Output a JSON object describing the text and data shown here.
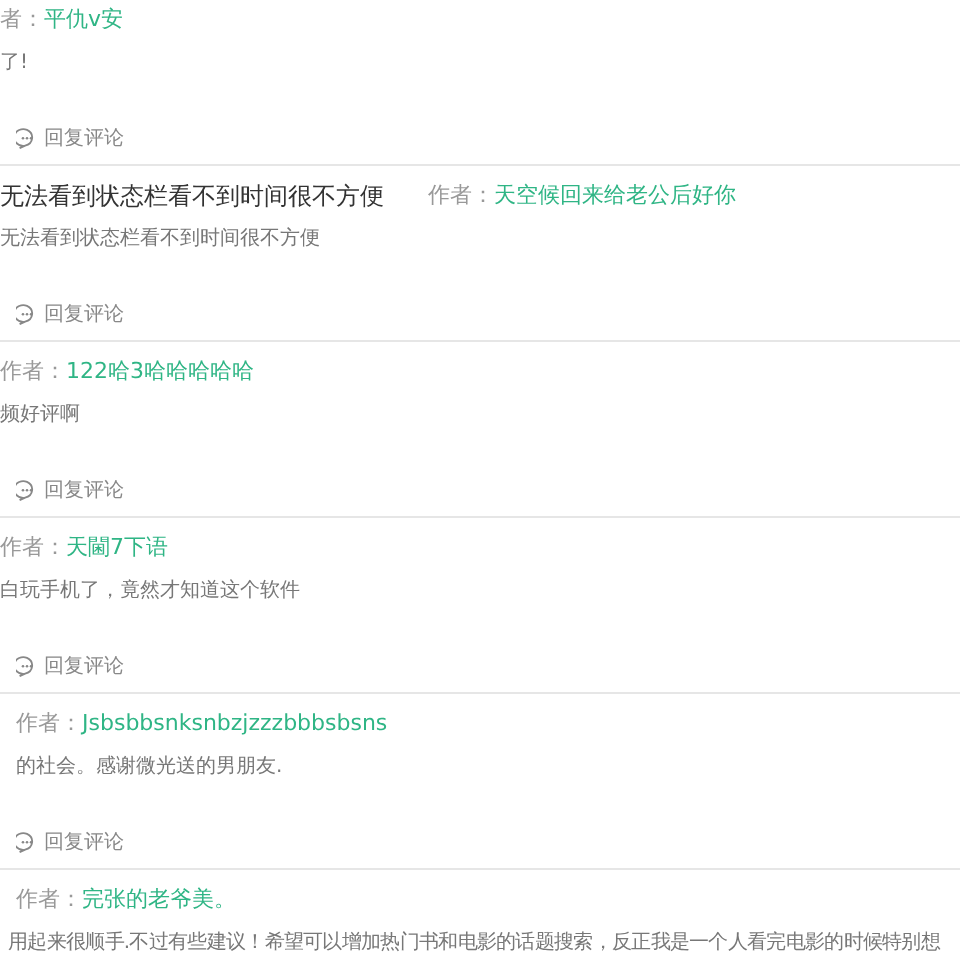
{
  "comments": [
    {
      "author_label": "者：",
      "author": "平仇v安",
      "body": "了!",
      "reply": "回复评论"
    },
    {
      "title": "无法看到状态栏看不到时间很不方便",
      "author_label": "作者：",
      "author": "天空候回来给老公后好你",
      "body": "无法看到状态栏看不到时间很不方便",
      "reply": "回复评论"
    },
    {
      "author_label": "作者：",
      "author": "122哈3哈哈哈哈哈",
      "body": "频好评啊",
      "reply": "回复评论"
    },
    {
      "author_label": "作者：",
      "author": "天閫7下语",
      "body": "白玩手机了，竟然才知道这个软件",
      "reply": "回复评论"
    },
    {
      "author_label": "作者：",
      "author": "Jsbsbbsnksnbzjzzzbbbsbsns",
      "body": "的社会。感谢微光送的男朋友.",
      "reply": "回复评论"
    },
    {
      "author_label": "作者：",
      "author": "完张的老爷美。",
      "body": "用起来很顺手.不过有些建议！希望可以增加热门书和电影的话题搜索，反正我是一个人看完电影的时候特别想"
    }
  ]
}
